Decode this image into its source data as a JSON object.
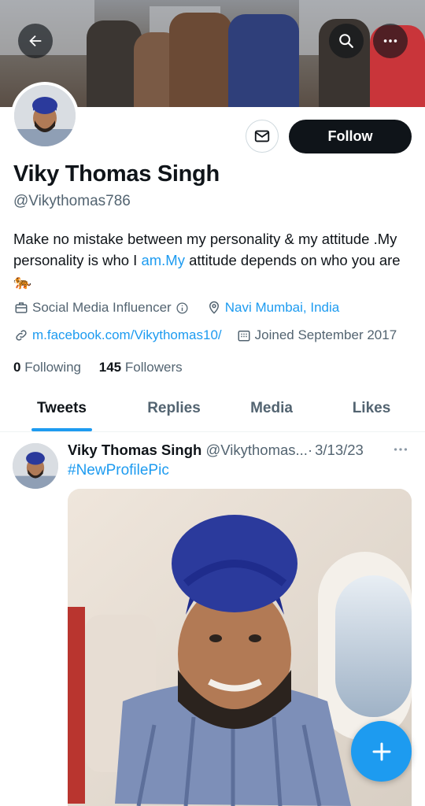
{
  "header": {
    "back_icon": "arrow-left-icon",
    "search_icon": "search-icon",
    "more_icon": "more-horizontal-icon"
  },
  "profile": {
    "name": "Viky Thomas Singh",
    "handle": "@Vikythomas786",
    "follow_label": "Follow",
    "message_icon": "mail-icon",
    "bio": {
      "part1": "Make no mistake between my personality & my attitude .My personality is who I ",
      "link": "am.My",
      "part2": " attitude depends on who you are",
      "emoji": "🐅"
    },
    "category": "Social Media Influencer",
    "location": "Navi Mumbai, India",
    "website": "m.facebook.com/Vikythomas10/",
    "joined": "Joined September 2017",
    "following_count": "0",
    "following_label": "Following",
    "followers_count": "145",
    "followers_label": "Followers"
  },
  "tabs": [
    {
      "label": "Tweets",
      "active": true
    },
    {
      "label": "Replies",
      "active": false
    },
    {
      "label": "Media",
      "active": false
    },
    {
      "label": "Likes",
      "active": false
    }
  ],
  "tweet": {
    "author": "Viky Thomas Singh",
    "handle": "@Vikythomas...",
    "separator": "·",
    "date": "3/13/23",
    "hashtag": "#NewProfilePic"
  },
  "colors": {
    "accent": "#1d9bf0",
    "text": "#0f1419",
    "secondary": "#536471",
    "turban": "#2b3a9c"
  }
}
